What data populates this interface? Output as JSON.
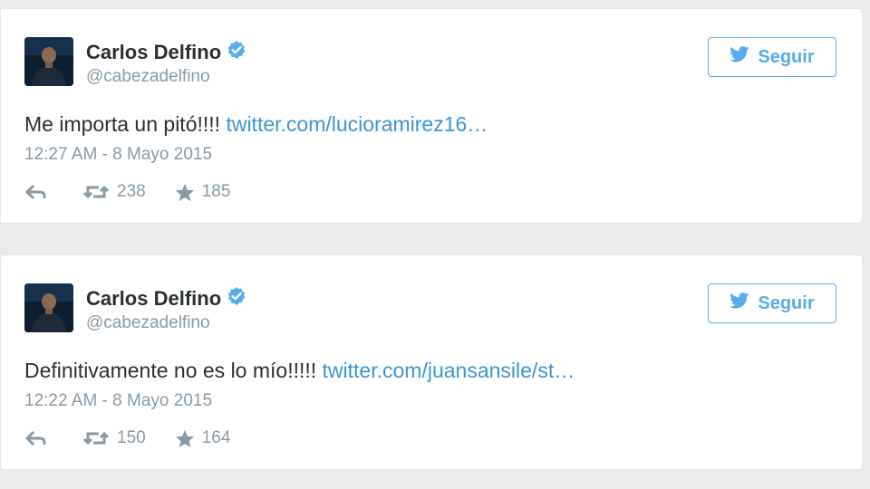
{
  "tweets": [
    {
      "author_name": "Carlos Delfino",
      "author_handle": "@cabezadelfino",
      "follow_label": "Seguir",
      "text": "Me importa un pitó!!!! ",
      "link_text": "twitter.com/lucioramirez16…",
      "timestamp": "12:27 AM - 8 Mayo 2015",
      "retweets": "238",
      "favorites": "185",
      "icons": [
        "avatar-photo",
        "verified-badge-icon",
        "twitter-bird-icon",
        "reply-icon",
        "retweet-icon",
        "star-icon"
      ]
    },
    {
      "author_name": "Carlos Delfino",
      "author_handle": "@cabezadelfino",
      "follow_label": "Seguir",
      "text": "Definitivamente no es lo mío!!!!! ",
      "link_text": "twitter.com/juansansile/st…",
      "timestamp": "12:22 AM - 8 Mayo 2015",
      "retweets": "150",
      "favorites": "164",
      "icons": [
        "avatar-photo",
        "verified-badge-icon",
        "twitter-bird-icon",
        "reply-icon",
        "retweet-icon",
        "star-icon"
      ]
    }
  ],
  "colors": {
    "background": "#e9ebec",
    "card": "#ffffff",
    "accent": "#55acee",
    "link": "#3b94d9",
    "text": "#292f33",
    "muted": "#8899a6"
  }
}
